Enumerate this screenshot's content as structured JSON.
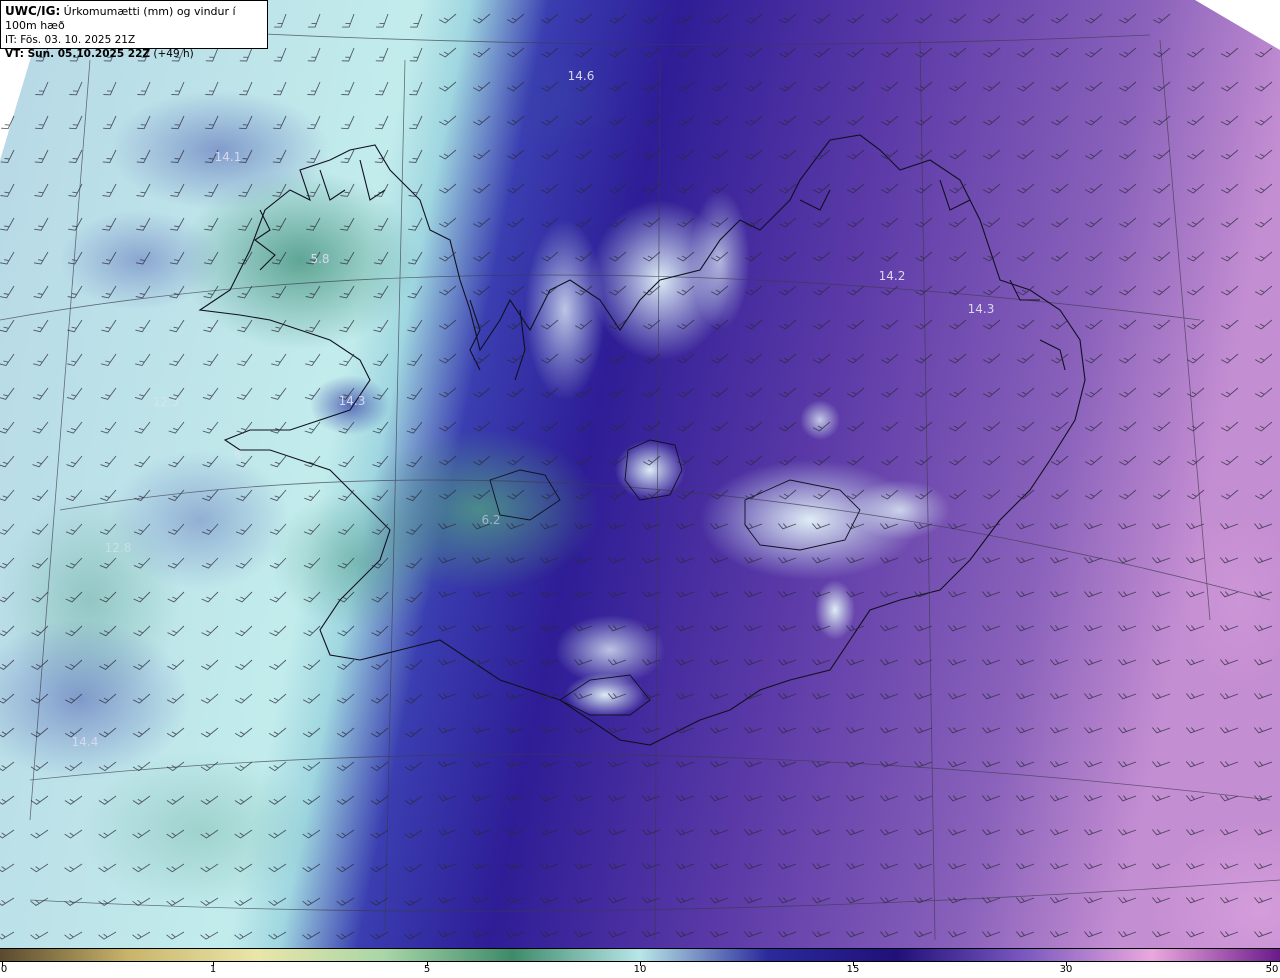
{
  "header": {
    "model": "UWC/IG:",
    "description": "Úrkomumætti (mm) og vindur í 100m hæð",
    "initial_time": "IT: Fös. 03. 10. 2025 21Z",
    "valid_prefix": "VT: Sun. 05.10.2025 22Z",
    "valid_suffix": "(+49 h)"
  },
  "value_labels": [
    {
      "text": "14.6",
      "faint": false
    },
    {
      "text": "14.1",
      "faint": false
    },
    {
      "text": "5.8",
      "faint": false
    },
    {
      "text": "14.2",
      "faint": false
    },
    {
      "text": "14.3",
      "faint": false
    },
    {
      "text": "12.3",
      "faint": true
    },
    {
      "text": "14.3",
      "faint": false
    },
    {
      "text": "6",
      "faint": true
    },
    {
      "text": "6.2",
      "faint": true
    },
    {
      "text": "12.8",
      "faint": true
    },
    {
      "text": "14.4",
      "faint": false
    }
  ],
  "colorbar": {
    "unit": "mm",
    "ticks": [
      "0",
      "1",
      "5",
      "10",
      "15",
      "30",
      "50"
    ],
    "colors": [
      "#5a4a2e",
      "#c8b46a",
      "#eae6a8",
      "#a8d6a8",
      "#3e8a6a",
      "#b8e6e8",
      "#2a2a9c",
      "#20107a",
      "#7a58c0",
      "#e9a8de",
      "#6a1a8a"
    ]
  },
  "wind": {
    "direction_north_side": "southwesterly",
    "direction_south_side": "northwesterly"
  }
}
